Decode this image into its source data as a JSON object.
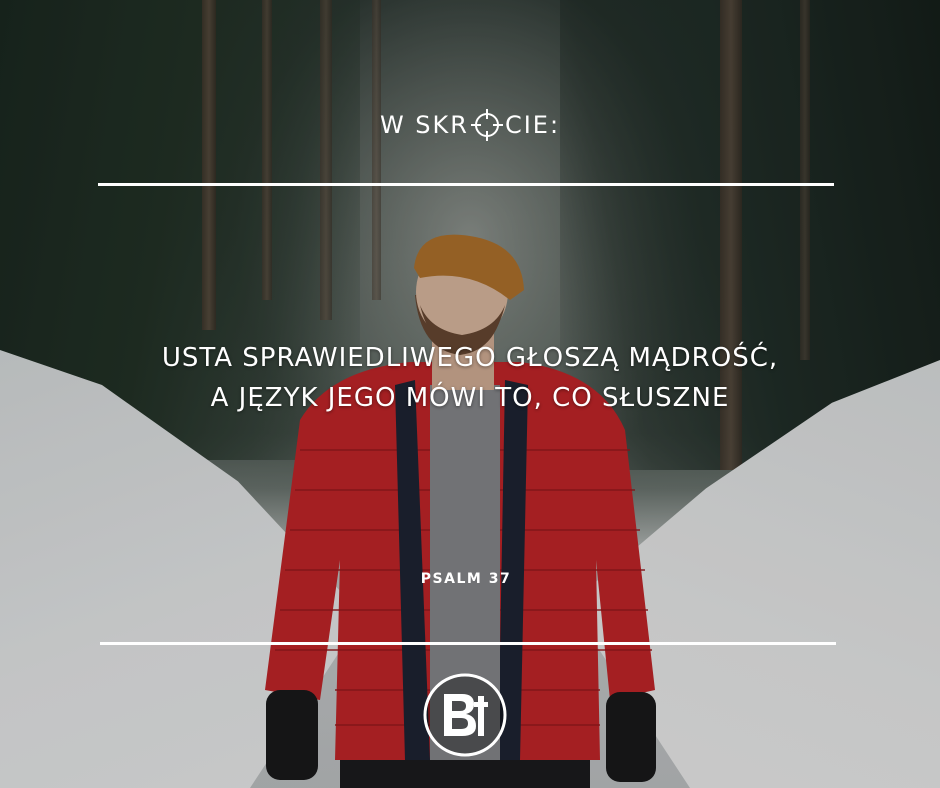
{
  "header": {
    "title_left": "W SKR",
    "title_right": "CIE:",
    "icon": "crosshair-target-icon"
  },
  "quote": {
    "line1": "USTA SPRAWIEDLIWEGO GŁOSZĄ MĄDROŚĆ,",
    "line2": "A JĘZYK JEGO MÓWI TO, CO SŁUSZNE"
  },
  "reference": "PSALM 37",
  "logo": {
    "icon": "bt-logo-icon"
  },
  "colors": {
    "text": "#ffffff",
    "jacket": "#c8262a",
    "beanie": "#b5762e"
  }
}
